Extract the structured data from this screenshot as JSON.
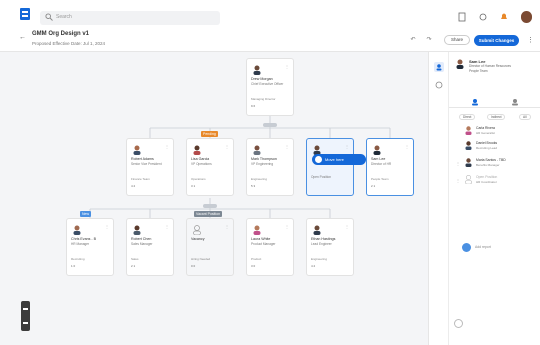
{
  "topbar": {
    "search_placeholder": "Search"
  },
  "header": {
    "title": "GMM Org Design v1",
    "subtitle": "Proposed Effective Date: Jul 1, 2024",
    "button_secondary": "Share",
    "button_primary": "Submit Changes"
  },
  "cards": [
    {
      "name": "Drew Morgan",
      "role": "Chief Executive Officer",
      "meta": "Managing Director",
      "counts": "9   6"
    },
    {
      "name": "Robert Adams",
      "role": "Senior Vice President",
      "meta": "Finance Team",
      "counts": "4   2"
    },
    {
      "name": "Lisa Garcia",
      "role": "VP Operations",
      "meta": "Operations",
      "counts": "3   1"
    },
    {
      "name": "Mark Thompson",
      "role": "VP Engineering",
      "meta": "Engineering",
      "counts": "5   3"
    },
    {
      "name": "",
      "role": "Open Position",
      "meta": "",
      "counts": ""
    },
    {
      "name": "Sam Lee",
      "role": "Director of HR",
      "meta": "People Team",
      "counts": "2   1"
    },
    {
      "name": "Chris Evans - B",
      "role": "HR Manager",
      "meta": "Recruiting",
      "counts": "1   0"
    },
    {
      "name": "Robert Chen",
      "role": "Sales Manager",
      "meta": "Sales",
      "counts": "2   1"
    },
    {
      "name": "Vacancy",
      "role": "",
      "meta": "Hiring Needed",
      "counts": "0   0"
    },
    {
      "name": "Laura White",
      "role": "Product Manager",
      "meta": "Product",
      "counts": "3   0"
    },
    {
      "name": "Ethan Hastings",
      "role": "Lead Engineer",
      "meta": "Engineering",
      "counts": "4   2"
    }
  ],
  "tags": {
    "pending": "Pending",
    "new": "New",
    "vacant": "Vacant Position"
  },
  "drag_pill": "Move here",
  "panel": {
    "name": "Sam Lee",
    "role": "Director of Human Resources",
    "sub": "People Team",
    "filters": [
      "Direct",
      "Indirect",
      "All"
    ],
    "reports": [
      {
        "name": "Carla Rivera",
        "role": "HR Generalist"
      },
      {
        "name": "Daniel Brooks",
        "role": "Recruiting Lead"
      },
      {
        "name": "Maria Santos - TBD",
        "role": "Benefits Manager"
      },
      {
        "name": "Open Position",
        "role": "HR Coordinator"
      }
    ],
    "add_label": "Add report"
  },
  "colors": {
    "primary": "#1468d8",
    "tag_orange": "#e8892b",
    "tag_blue": "#4a90e2",
    "tag_gray": "#7d8894"
  }
}
